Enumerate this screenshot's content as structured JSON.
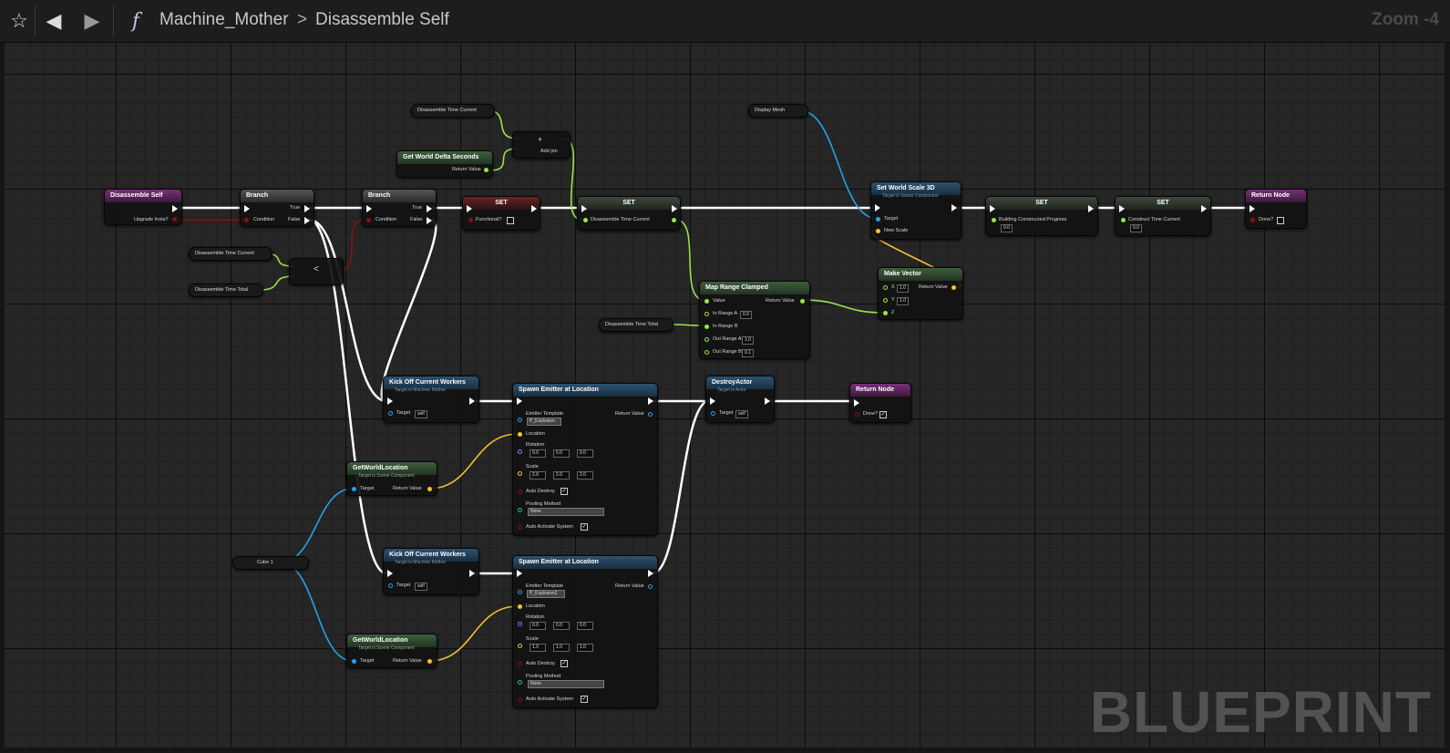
{
  "toolbar": {
    "function_glyph": "f",
    "breadcrumb_parent": "Machine_Mother",
    "breadcrumb_separator": ">",
    "breadcrumb_current": "Disassemble Self",
    "zoom": "Zoom -4"
  },
  "watermark": "BLUEPRINT",
  "nodes": {
    "entry": {
      "title": "Disassemble Self",
      "pin": "Upgrade Insta?"
    },
    "branch1": {
      "title": "Branch",
      "condition": "Condition",
      "true": "True",
      "false": "False"
    },
    "branch2": {
      "title": "Branch",
      "condition": "Condition",
      "true": "True",
      "false": "False"
    },
    "set_functional": {
      "title": "SET",
      "pin": "Functional?"
    },
    "set_time": {
      "title": "SET",
      "pin": "Disassemble Time Current"
    },
    "set_scale": {
      "title": "Set World Scale 3D",
      "subtitle": "Target is Scene Component",
      "target": "Target",
      "new_scale": "New Scale"
    },
    "set_progress": {
      "title": "SET",
      "pin": "Building Constructed Progress",
      "value": "0.0"
    },
    "set_construct": {
      "title": "SET",
      "pin": "Construct Time Current",
      "value": "0.0"
    },
    "return_top": {
      "title": "Return Node",
      "pin": "Done?"
    },
    "var_time_current_a": {
      "label": "Disassemble Time Current"
    },
    "var_time_current_b": {
      "label": "Disassemble Time Current"
    },
    "var_time_total_a": {
      "label": "Disassemble Time Total"
    },
    "var_time_total_b": {
      "label": "Disassemble Time Total"
    },
    "var_display_mesh": {
      "label": "Display Mesh"
    },
    "var_cube": {
      "label": "Cube 1"
    },
    "add": {
      "symbol": "+",
      "add_pin": "Add pin"
    },
    "less": {
      "symbol": "<"
    },
    "delta": {
      "title": "Get World Delta Seconds",
      "return": "Return Value"
    },
    "map_range": {
      "title": "Map Range Clamped",
      "value": "Value",
      "return": "Return Value",
      "in_a": "In Range A",
      "in_a_val": "0.0",
      "in_b": "In Range B",
      "out_a": "Out Range A",
      "out_a_val": "1.0",
      "out_b": "Out Range B",
      "out_b_val": "0.1"
    },
    "make_vector": {
      "title": "Make Vector",
      "x": "X",
      "x_val": "1.0",
      "y": "Y",
      "y_val": "1.0",
      "z": "Z",
      "return": "Return Value"
    },
    "kick1": {
      "title": "Kick Off Current Workers",
      "subtitle": "Target is Machine Mother",
      "target": "Target",
      "target_val": "self"
    },
    "kick2": {
      "title": "Kick Off Current Workers",
      "subtitle": "Target is Machine Mother",
      "target": "Target",
      "target_val": "self"
    },
    "spawn1": {
      "title": "Spawn Emitter at Location",
      "template": "Emitter Template",
      "template_val": "P_Explosion",
      "return": "Return Value",
      "location": "Location",
      "rotation": "Rotation",
      "rot": [
        "0.0",
        "0.0",
        "0.0"
      ],
      "scale": "Scale",
      "scl": [
        "2.0",
        "2.0",
        "2.0"
      ],
      "auto_destroy": "Auto Destroy",
      "pooling": "Pooling Method",
      "pooling_val": "None",
      "auto_activate": "Auto Activate System"
    },
    "spawn2": {
      "title": "Spawn Emitter at Location",
      "template": "Emitter Template",
      "template_val": "P_Explosion2",
      "return": "Return Value",
      "location": "Location",
      "rotation": "Rotation",
      "rot": [
        "0.0",
        "0.0",
        "0.0"
      ],
      "scale": "Scale",
      "scl": [
        "1.0",
        "1.0",
        "1.0"
      ],
      "auto_destroy": "Auto Destroy",
      "pooling": "Pooling Method",
      "pooling_val": "None",
      "auto_activate": "Auto Activate System"
    },
    "getloc1": {
      "title": "GetWorldLocation",
      "subtitle": "Target is Scene Component",
      "target": "Target",
      "return": "Return Value"
    },
    "getloc2": {
      "title": "GetWorldLocation",
      "subtitle": "Target is Scene Component",
      "target": "Target",
      "return": "Return Value"
    },
    "destroy": {
      "title": "DestroyActor",
      "subtitle": "Target is Actor",
      "target": "Target",
      "target_val": "self"
    },
    "return_mid": {
      "title": "Return Node",
      "pin": "Done?"
    }
  },
  "colors": {
    "exec": "#ffffff",
    "float": "#9ae34a",
    "bool": "#8c0f0f",
    "vector": "#f5c22e",
    "object": "#22a3e8",
    "struct": "#8c7aff"
  }
}
